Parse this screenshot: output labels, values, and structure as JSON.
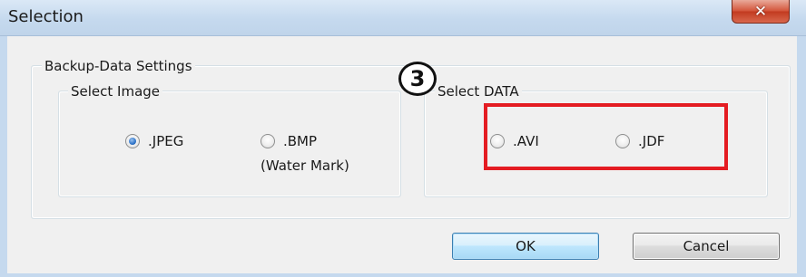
{
  "window": {
    "title": "Selection",
    "close_glyph": "✕"
  },
  "backup_group": {
    "label": "Backup-Data Settings"
  },
  "image_group": {
    "label": "Select Image",
    "options": [
      {
        "label": ".JPEG",
        "checked": true
      },
      {
        "label": ".BMP",
        "sublabel": "(Water Mark)",
        "checked": false
      }
    ]
  },
  "data_group": {
    "label": "Select DATA",
    "options": [
      {
        "label": ".AVI",
        "checked": false
      },
      {
        "label": ".JDF",
        "checked": false
      }
    ]
  },
  "annotation": {
    "step_number": "3",
    "highlight_color": "#e41c22"
  },
  "buttons": {
    "ok_label": "OK",
    "cancel_label": "Cancel"
  },
  "colors": {
    "titlebar": "#c5d9ee",
    "close_button": "#c23a20",
    "dialog_background": "#f0f0f0",
    "radio_selected": "#2f74c9"
  }
}
